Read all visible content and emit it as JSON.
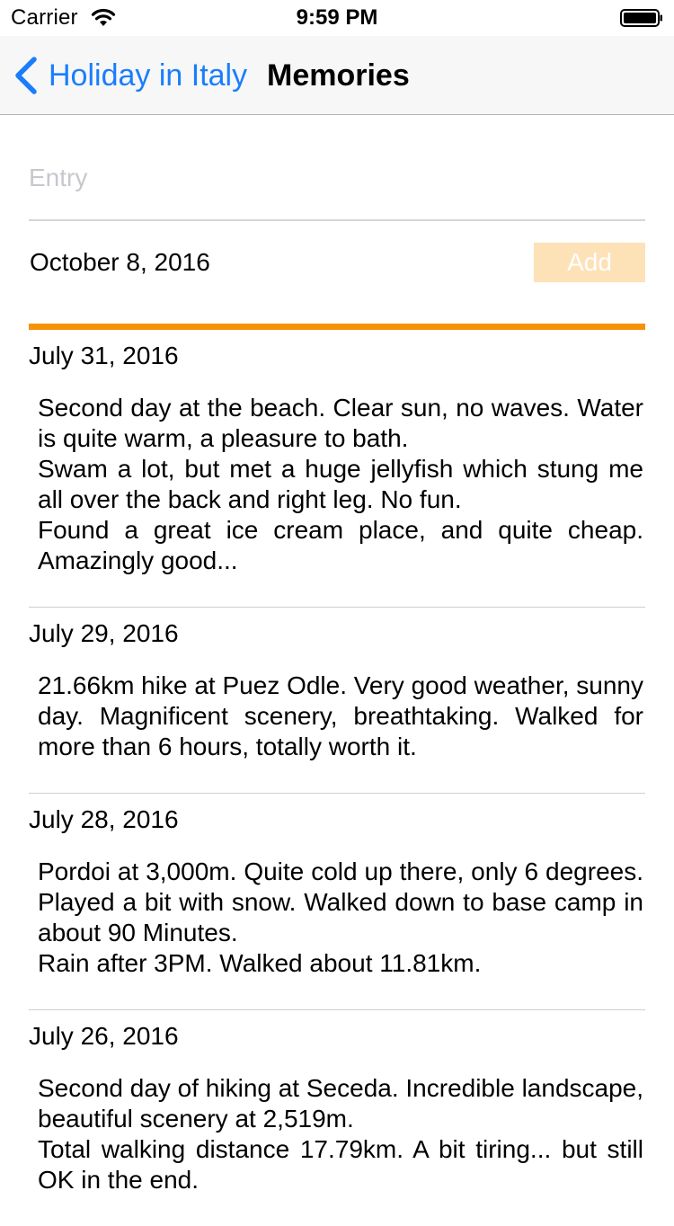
{
  "status_bar": {
    "carrier": "Carrier",
    "time": "9:59 PM"
  },
  "nav": {
    "back_label": "Holiday in Italy",
    "title": "Memories",
    "accent_color": "#1a7efb"
  },
  "form": {
    "entry_placeholder": "Entry",
    "entry_value": "",
    "date": "October 8, 2016",
    "add_label": "Add",
    "add_button_color": "#fde1b7",
    "separator_color": "#f5920a"
  },
  "memories": [
    {
      "date": "July 31, 2016",
      "paragraphs": [
        "Second day at the beach. Clear sun, no waves. Water is quite warm, a pleasure to bath.",
        "Swam a lot, but met a huge jellyfish which stung me all over the back and right leg. No fun.",
        "Found a great ice cream place, and quite cheap. Amazingly good..."
      ]
    },
    {
      "date": "July 29, 2016",
      "paragraphs": [
        "21.66km hike at Puez Odle. Very good weather, sunny day. Magnificent scenery, breathtaking. Walked for more than 6 hours, totally worth it."
      ]
    },
    {
      "date": "July 28, 2016",
      "paragraphs": [
        "Pordoi at 3,000m. Quite cold up there, only 6 degrees. Played a bit with snow. Walked down to base camp in about 90 Minutes.",
        "Rain after 3PM. Walked about 11.81km."
      ]
    },
    {
      "date": "July 26, 2016",
      "paragraphs": [
        "Second day of hiking at Seceda. Incredible landscape, beautiful scenery at 2,519m.",
        "Total walking distance 17.79km. A bit tiring... but still OK in the end."
      ]
    }
  ]
}
